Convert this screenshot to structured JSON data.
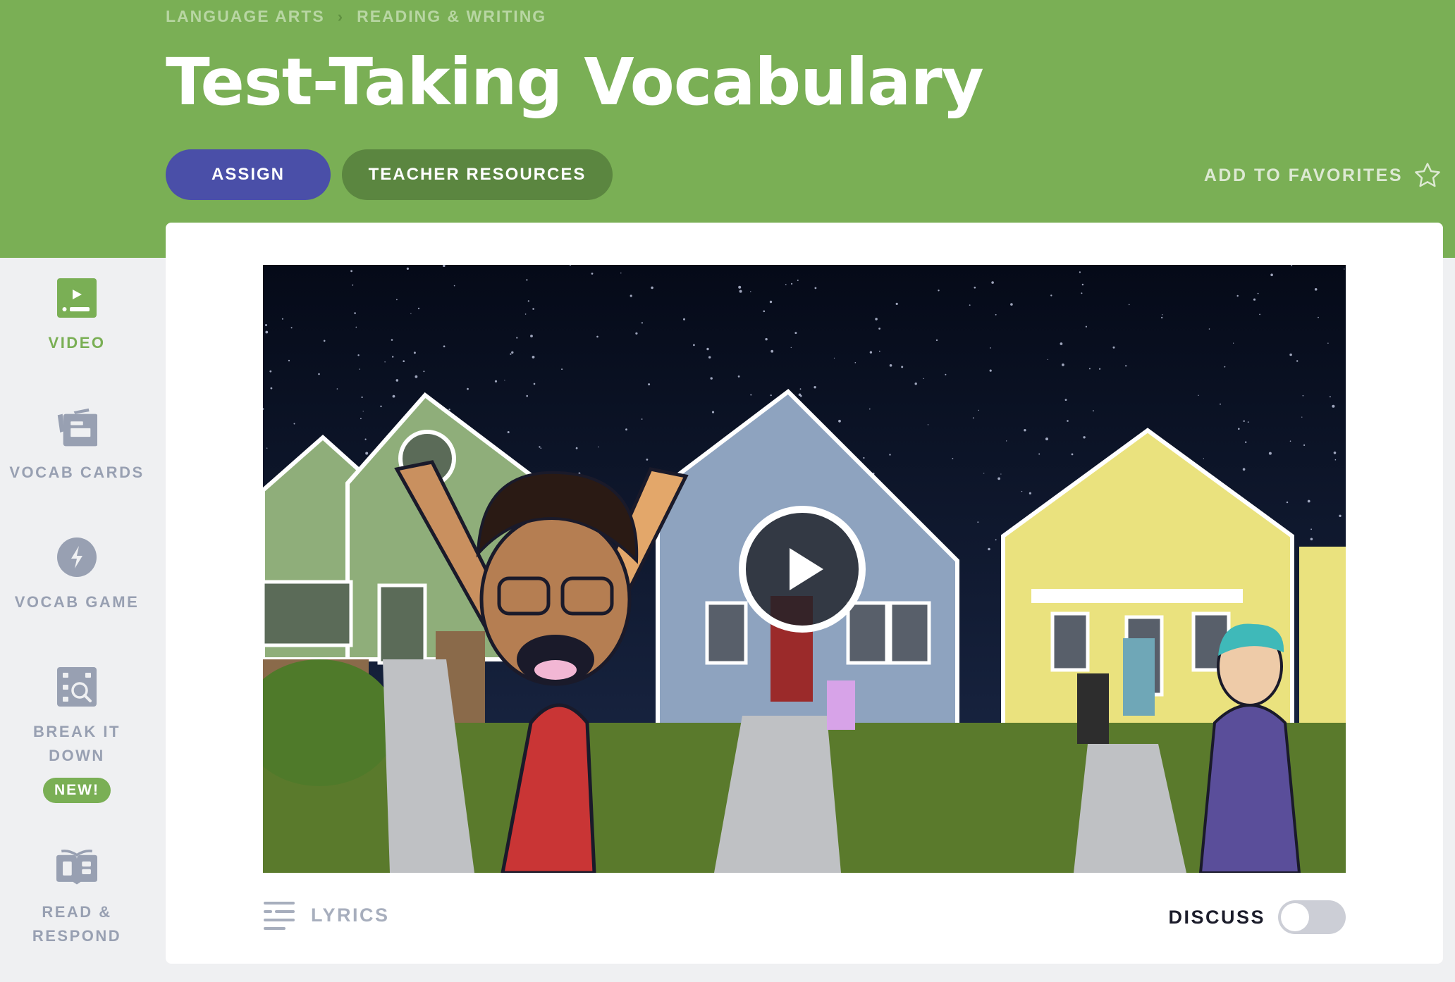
{
  "breadcrumb": {
    "items": [
      "LANGUAGE ARTS",
      "READING & WRITING"
    ],
    "separator": "›"
  },
  "header": {
    "title": "Test-Taking Vocabulary",
    "assign_label": "ASSIGN",
    "teacher_resources_label": "TEACHER RESOURCES",
    "favorites_label": "ADD TO FAVORITES",
    "favorites_icon": "star-outline-icon"
  },
  "sidebar": {
    "items": [
      {
        "label": "VIDEO",
        "icon": "video-icon",
        "active": true
      },
      {
        "label": "VOCAB CARDS",
        "icon": "vocab-cards-icon",
        "active": false
      },
      {
        "label": "VOCAB GAME",
        "icon": "lightning-icon",
        "active": false
      },
      {
        "label": "BREAK IT DOWN",
        "icon": "break-it-down-icon",
        "active": false,
        "badge": "NEW!"
      },
      {
        "label": "READ & RESPOND",
        "icon": "book-icon",
        "active": false
      }
    ]
  },
  "video": {
    "play_icon": "play-icon",
    "description": "Animated neighborhood scene at night with a boy cheering"
  },
  "footer": {
    "lyrics_label": "LYRICS",
    "discuss_label": "DISCUSS",
    "discuss_enabled": false
  },
  "colors": {
    "brand_green": "#7aaf55",
    "assign_purple": "#4a4fa8",
    "teacher_green": "#5b8640",
    "muted_gray": "#98a0b2"
  }
}
